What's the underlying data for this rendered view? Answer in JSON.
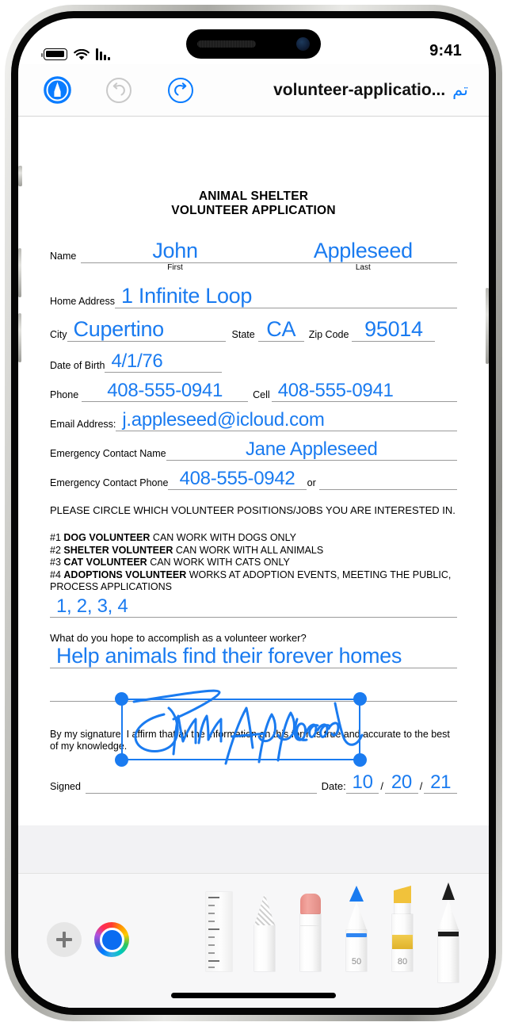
{
  "status_bar": {
    "time": "9:41",
    "battery_icon": "battery-icon",
    "wifi_icon": "wifi-icon",
    "signal_icon": "cellular-signal-icon"
  },
  "nav_bar": {
    "markup_icon": "markup-pen-icon",
    "undo_icon": "undo-arrow-icon",
    "redo_icon": "redo-arrow-icon",
    "title": "volunteer-applicatio...",
    "done_label": "تم"
  },
  "document": {
    "title_line1": "ANIMAL SHELTER",
    "title_line2": "VOLUNTEER APPLICATION",
    "fields": {
      "name_label": "Name",
      "first_sublabel": "First",
      "last_sublabel": "Last",
      "first_name": "John",
      "last_name": "Appleseed",
      "home_address_label": "Home Address",
      "home_address": "1 Infinite Loop",
      "city_label": "City",
      "city": "Cupertino",
      "state_label": "State",
      "state": "CA",
      "zip_label": "Zip Code",
      "zip": "95014",
      "dob_label": "Date of Birth",
      "dob": "4/1/76",
      "phone_label": "Phone",
      "phone": "408-555-0941",
      "cell_label": "Cell",
      "cell": "408-555-0941",
      "email_label": "Email Address:",
      "email": "j.appleseed@icloud.com",
      "emergency_name_label": "Emergency Contact Name",
      "emergency_name": "Jane Appleseed",
      "emergency_phone_label": "Emergency Contact Phone",
      "emergency_phone": "408-555-0942",
      "or_label": "or"
    },
    "instructions": "PLEASE CIRCLE WHICH VOLUNTEER POSITIONS/JOBS YOU ARE INTERESTED IN.",
    "jobs": [
      {
        "number": "#1 ",
        "title": "DOG VOLUNTEER",
        "description": " CAN WORK WITH DOGS ONLY"
      },
      {
        "number": "#2 ",
        "title": "SHELTER VOLUNTEER",
        "description": " CAN WORK WITH ALL ANIMALS"
      },
      {
        "number": "#3 ",
        "title": "CAT VOLUNTEER",
        "description": " CAN WORK WITH CATS ONLY"
      },
      {
        "number": "#4 ",
        "title": "ADOPTIONS VOLUNTEER",
        "description": " WORKS AT ADOPTION EVENTS, MEETING THE PUBLIC, PROCESS APPLICATIONS"
      }
    ],
    "jobs_answer": "1, 2, 3, 4",
    "hope_question": "What do you hope to accomplish as a volunteer worker?",
    "hope_answer": "Help animals find their forever homes",
    "affirmation": "By my signature, I affirm that all the information on this form is true and accurate to the best of my knowledge.",
    "signed_label": "Signed",
    "signature_value": "John Appleseed",
    "date_label": "Date:",
    "date_month": "10",
    "date_day": "20",
    "date_year": "21",
    "date_separator": "/"
  },
  "palette": {
    "add_label": "+",
    "color_name": "color-picker",
    "selected_color": "#0a6cf1",
    "tools": [
      {
        "name": "ruler",
        "value": ""
      },
      {
        "name": "pencil",
        "value": ""
      },
      {
        "name": "eraser",
        "value": ""
      },
      {
        "name": "pen",
        "value": "50"
      },
      {
        "name": "highlighter",
        "value": "80"
      },
      {
        "name": "marker",
        "value": ""
      }
    ]
  },
  "colors": {
    "accent_blue": "#0a7cff",
    "ink_blue": "#1a7bf0",
    "eraser_pink": "#e88b85",
    "highlighter_yellow": "#f1c23b",
    "marker_black": "#1d1d1d"
  }
}
